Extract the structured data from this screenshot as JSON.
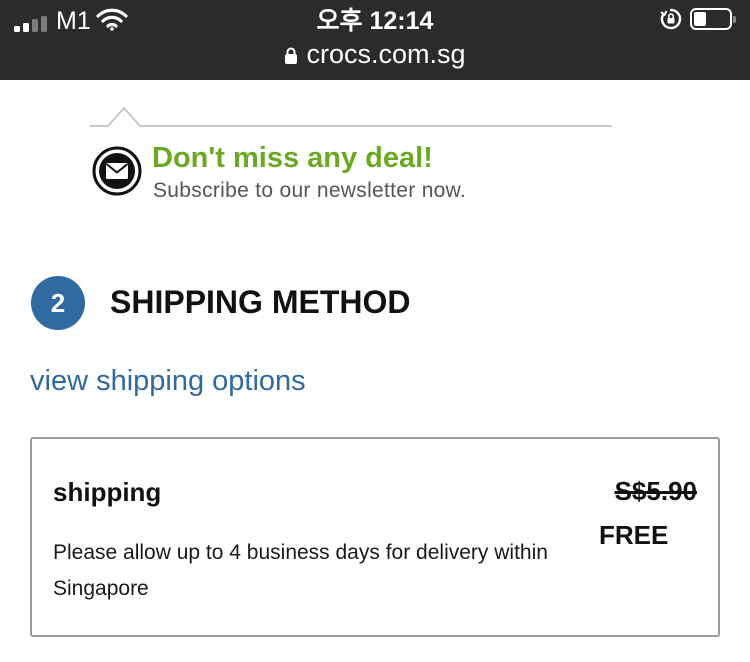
{
  "status_bar": {
    "carrier": "M1",
    "time": "오후 12:14",
    "battery_level": 0.3
  },
  "browser": {
    "url": "crocs.com.sg"
  },
  "newsletter": {
    "title": "Don't miss any deal!",
    "subtitle": "Subscribe to our newsletter now."
  },
  "shipping_section": {
    "step_number": "2",
    "title": "SHIPPING METHOD",
    "view_options_link": "view shipping options",
    "option": {
      "name": "shipping",
      "description": "Please allow up to 4 business days for delivery within Singapore",
      "original_price": "S$5.90",
      "price": "FREE"
    }
  },
  "colors": {
    "status_bar_bg": "#2b2b2d",
    "accent_blue": "#2f6aa1",
    "deal_green": "#6aaa22",
    "card_border": "#9a9a9a"
  }
}
